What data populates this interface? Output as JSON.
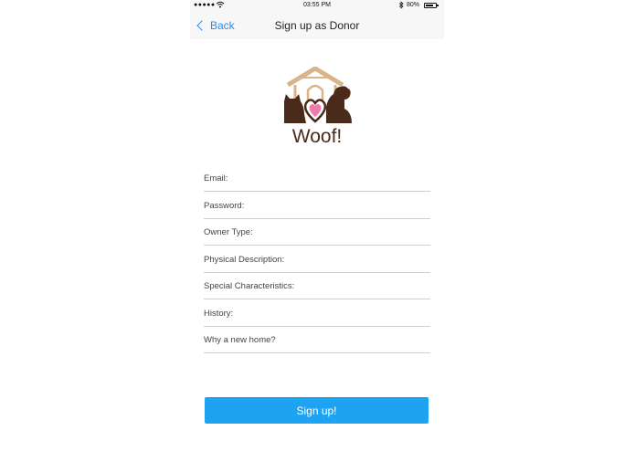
{
  "status_bar": {
    "signal": "●●●●●",
    "time": "03:55 PM",
    "battery_text": "80%",
    "battery_level": 0.8
  },
  "nav": {
    "back_label": "Back",
    "title": "Sign up as Donor"
  },
  "logo": {
    "text": "Woof!"
  },
  "form": {
    "fields": [
      {
        "placeholder": "Email:"
      },
      {
        "placeholder": "Password:"
      },
      {
        "placeholder": "Owner Type:"
      },
      {
        "placeholder": "Physical Description:"
      },
      {
        "placeholder": "Special Characteristics:"
      },
      {
        "placeholder": "History:"
      },
      {
        "placeholder": "Why a new home?"
      }
    ],
    "submit_label": "Sign up!"
  },
  "colors": {
    "accent": "#2a8cf0",
    "button": "#1ea3f2",
    "logo_brown": "#4a2a1a",
    "roof": "#d9b48a",
    "heart": "#f07aa8"
  }
}
